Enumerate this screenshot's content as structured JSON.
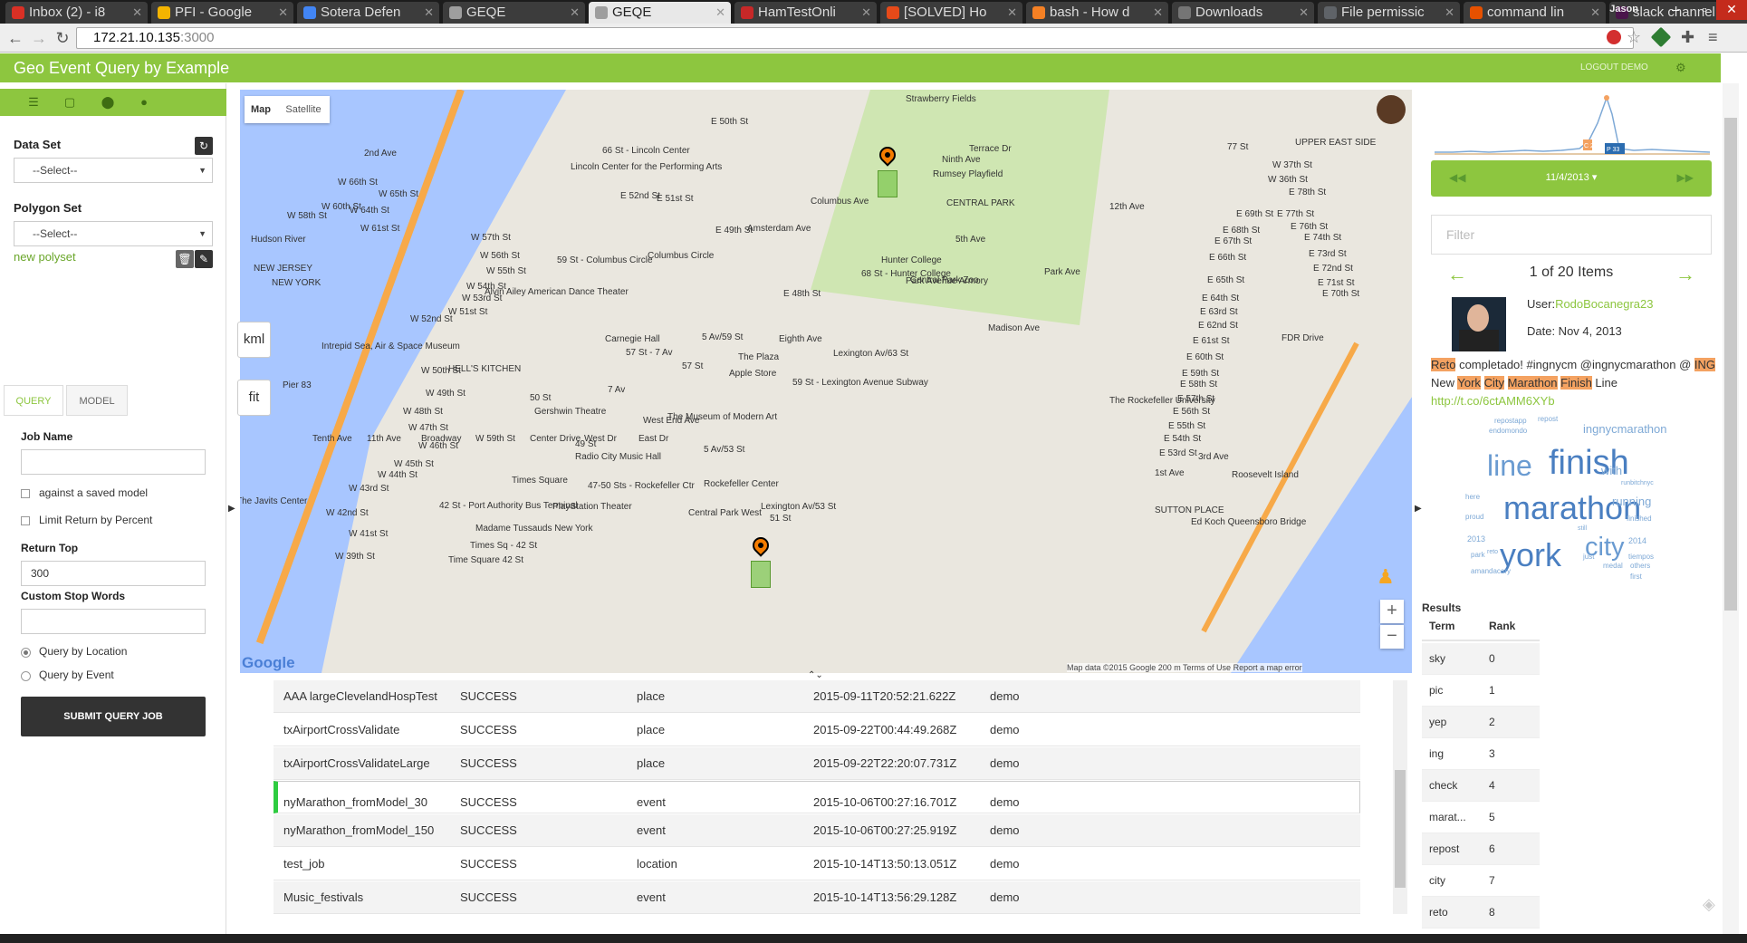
{
  "browser": {
    "tabs": [
      {
        "title": "Inbox (2) - i8",
        "color": "#d93025"
      },
      {
        "title": "PFI - Google",
        "color": "#f4b400"
      },
      {
        "title": "Sotera Defen",
        "color": "#4285f4"
      },
      {
        "title": "GEQE",
        "color": "#9e9e9e"
      },
      {
        "title": "GEQE",
        "color": "#9e9e9e",
        "active": true
      },
      {
        "title": "HamTestOnli",
        "color": "#c62828"
      },
      {
        "title": "[SOLVED] Ho",
        "color": "#e64a19"
      },
      {
        "title": "bash - How d",
        "color": "#f48024"
      },
      {
        "title": "Downloads",
        "color": "#757575"
      },
      {
        "title": "File permissic",
        "color": "#5f6368"
      },
      {
        "title": "command lin",
        "color": "#e65100"
      },
      {
        "title": "slack channel",
        "color": "#4a154b"
      }
    ],
    "user": "Jason",
    "url_host": "172.21.10.135",
    "url_port": ":3000"
  },
  "app": {
    "title": "Geo Event Query by Example",
    "logout": "LOGOUT DEMO",
    "accent": "#8dc63f"
  },
  "sidebar": {
    "data_set_label": "Data Set",
    "data_set_value": "--Select--",
    "polygon_set_label": "Polygon Set",
    "polygon_set_value": "--Select--",
    "new_polyset": "new polyset",
    "tabs": [
      "QUERY",
      "MODEL"
    ],
    "job_name_label": "Job Name",
    "job_name_value": "",
    "against_saved_model": "against a saved model",
    "limit_return": "Limit Return by Percent",
    "return_top_label": "Return Top",
    "return_top_value": "300",
    "custom_stop_words_label": "Custom Stop Words",
    "custom_stop_words_value": "",
    "query_by_location": "Query by Location",
    "query_by_event": "Query by Event",
    "submit": "SUBMIT QUERY JOB"
  },
  "map": {
    "map_btn": "Map",
    "satellite_btn": "Satellite",
    "kml_btn": "kml",
    "fit_btn": "fit",
    "attribution": "Map data ©2015 Google    200 m            Terms of Use    Report a map error",
    "labels": [
      "Strawberry Fields",
      "Terrace Dr",
      "Rumsey Playfield",
      "CENTRAL PARK",
      "66 St - Lincoln Center",
      "Lincoln Center for the Performing Arts",
      "59 St - Columbus Circle",
      "Columbus Circle",
      "Central Park Zoo",
      "Hunter College",
      "68 St - Hunter College",
      "Park Avenue Armory",
      "Alvin Ailey American Dance Theater",
      "Carnegie Hall",
      "57 St - 7 Av",
      "5 Av/59 St",
      "The Plaza",
      "Lexington Av/63 St",
      "Intrepid Sea, Air & Space Museum",
      "HELL'S KITCHEN",
      "57 St",
      "Apple Store",
      "59 St - Lexington Avenue Subway",
      "Pier 83",
      "50 St",
      "7 Av",
      "Gershwin Theatre",
      "The Museum of Modern Art",
      "The Rockefeller University",
      "49 St",
      "Radio City Music Hall",
      "5 Av/53 St",
      "Times Square",
      "47-50 Sts - Rockefeller Ctr",
      "Rockefeller Center",
      "The Javits Center",
      "42 St - Port Authority Bus Terminal",
      "PlayStation Theater",
      "Lexington Av/53 St",
      "51 St",
      "SUTTON PLACE",
      "Roosevelt Island",
      "Madame Tussauds New York",
      "Times Sq - 42 St",
      "Ed Koch Queensboro Bridge",
      "Time Square 42 St",
      "UPPER EAST SIDE",
      "77 St",
      "Hudson River",
      "NEW JERSEY",
      "NEW YORK",
      "FDR Drive",
      "12th Ave",
      "Park Ave",
      "Madison Ave",
      "5th Ave",
      "3rd Ave",
      "1st Ave",
      "2nd Ave",
      "W 66th St",
      "W 65th St",
      "W 64th St",
      "W 61st St",
      "W 60th St",
      "W 58th St",
      "W 57th St",
      "W 56th St",
      "W 55th St",
      "W 54th St",
      "W 53rd St",
      "W 52nd St",
      "W 51st St",
      "W 50th St",
      "W 49th St",
      "W 48th St",
      "W 47th St",
      "W 46th St",
      "W 45th St",
      "W 44th St",
      "W 43rd St",
      "W 42nd St",
      "W 41st St",
      "W 39th St",
      "W 37th St",
      "W 36th St",
      "E 78th St",
      "E 77th St",
      "E 76th St",
      "E 74th St",
      "E 73rd St",
      "E 72nd St",
      "E 71st St",
      "E 70th St",
      "E 69th St",
      "E 68th St",
      "E 67th St",
      "E 66th St",
      "E 65th St",
      "E 64th St",
      "E 63rd St",
      "E 62nd St",
      "E 61st St",
      "E 60th St",
      "E 59th St",
      "E 58th St",
      "E 57th St",
      "E 56th St",
      "E 55th St",
      "E 54th St",
      "E 53rd St",
      "E 52nd St",
      "E 51st St",
      "E 50th St",
      "E 49th St",
      "E 48th St",
      "Amsterdam Ave",
      "Columbus Ave",
      "West End Ave",
      "Central Park West",
      "Eighth Ave",
      "Ninth Ave",
      "Tenth Ave",
      "11th Ave",
      "Broadway",
      "W 59th St",
      "Center Drive",
      "West Dr",
      "East Dr"
    ]
  },
  "jobs": [
    {
      "name": "AAA largeClevelandHospTest",
      "status": "SUCCESS",
      "type": "place",
      "time": "2015-09-11T20:52:21.622Z",
      "user": "demo"
    },
    {
      "name": "txAirportCrossValidate",
      "status": "SUCCESS",
      "type": "place",
      "time": "2015-09-22T00:44:49.268Z",
      "user": "demo"
    },
    {
      "name": "txAirportCrossValidateLarge",
      "status": "SUCCESS",
      "type": "place",
      "time": "2015-09-22T22:20:07.731Z",
      "user": "demo"
    },
    {
      "name": "nyMarathon_fromModel_30",
      "status": "SUCCESS",
      "type": "event",
      "time": "2015-10-06T00:27:16.701Z",
      "user": "demo",
      "selected": true
    },
    {
      "name": "nyMarathon_fromModel_150",
      "status": "SUCCESS",
      "type": "event",
      "time": "2015-10-06T00:27:25.919Z",
      "user": "demo"
    },
    {
      "name": "test_job",
      "status": "SUCCESS",
      "type": "location",
      "time": "2015-10-14T13:50:13.051Z",
      "user": "demo"
    },
    {
      "name": "Music_festivals",
      "status": "SUCCESS",
      "type": "event",
      "time": "2015-10-14T13:56:29.128Z",
      "user": "demo"
    }
  ],
  "right": {
    "date": "11/4/2013",
    "filter_placeholder": "Filter",
    "items_count": "1 of 20 Items",
    "user_prefix": "User:",
    "user_name": "RodoBocanegra23",
    "date_line": "Date: Nov 4, 2013",
    "tweet": [
      {
        "t": "Reto",
        "h": true
      },
      {
        "t": " completado! #ingnycm @ingnycmarathon @ "
      },
      {
        "t": "ING",
        "h": true
      },
      {
        "t": " New "
      },
      {
        "t": "York",
        "h": true
      },
      {
        "t": " "
      },
      {
        "t": "City",
        "h": true
      },
      {
        "t": " "
      },
      {
        "t": "Marathon",
        "h": true
      },
      {
        "t": " "
      },
      {
        "t": "Finish",
        "h": true
      },
      {
        "t": " Line"
      }
    ],
    "tweet_link": "http://t.co/6ctAMM6XYb",
    "timeline_labels": [
      "C 2",
      "P 33"
    ],
    "cloud": [
      {
        "w": "repostapp",
        "s": 8
      },
      {
        "w": "repost",
        "s": 8
      },
      {
        "w": "endomondo",
        "s": 8
      },
      {
        "w": "ingnycmarathon",
        "s": 12
      },
      {
        "w": "line",
        "s": 30
      },
      {
        "w": "finish",
        "s": 36
      },
      {
        "w": "with",
        "s": 12
      },
      {
        "w": "runbitchnyc",
        "s": 7
      },
      {
        "w": "here",
        "s": 8
      },
      {
        "w": "marathon",
        "s": 34
      },
      {
        "w": "running",
        "s": 12
      },
      {
        "w": "proud",
        "s": 8
      },
      {
        "w": "finished",
        "s": 8
      },
      {
        "w": "still",
        "s": 7
      },
      {
        "w": "2013",
        "s": 9
      },
      {
        "w": "park",
        "s": 8
      },
      {
        "w": "reto",
        "s": 7
      },
      {
        "w": "york",
        "s": 34
      },
      {
        "w": "just",
        "s": 8
      },
      {
        "w": "city",
        "s": 28
      },
      {
        "w": "2014",
        "s": 9
      },
      {
        "w": "tiempos",
        "s": 8
      },
      {
        "w": "medal",
        "s": 8
      },
      {
        "w": "others",
        "s": 8
      },
      {
        "w": "amandacary",
        "s": 8
      },
      {
        "w": "first",
        "s": 8
      }
    ],
    "results_title": "Results",
    "results_headers": [
      "Term",
      "Rank"
    ],
    "results": [
      {
        "term": "sky",
        "rank": "0"
      },
      {
        "term": "pic",
        "rank": "1"
      },
      {
        "term": "yep",
        "rank": "2"
      },
      {
        "term": "ing",
        "rank": "3"
      },
      {
        "term": "check",
        "rank": "4"
      },
      {
        "term": "marat...",
        "rank": "5"
      },
      {
        "term": "repost",
        "rank": "6"
      },
      {
        "term": "city",
        "rank": "7"
      },
      {
        "term": "reto",
        "rank": "8"
      }
    ]
  }
}
